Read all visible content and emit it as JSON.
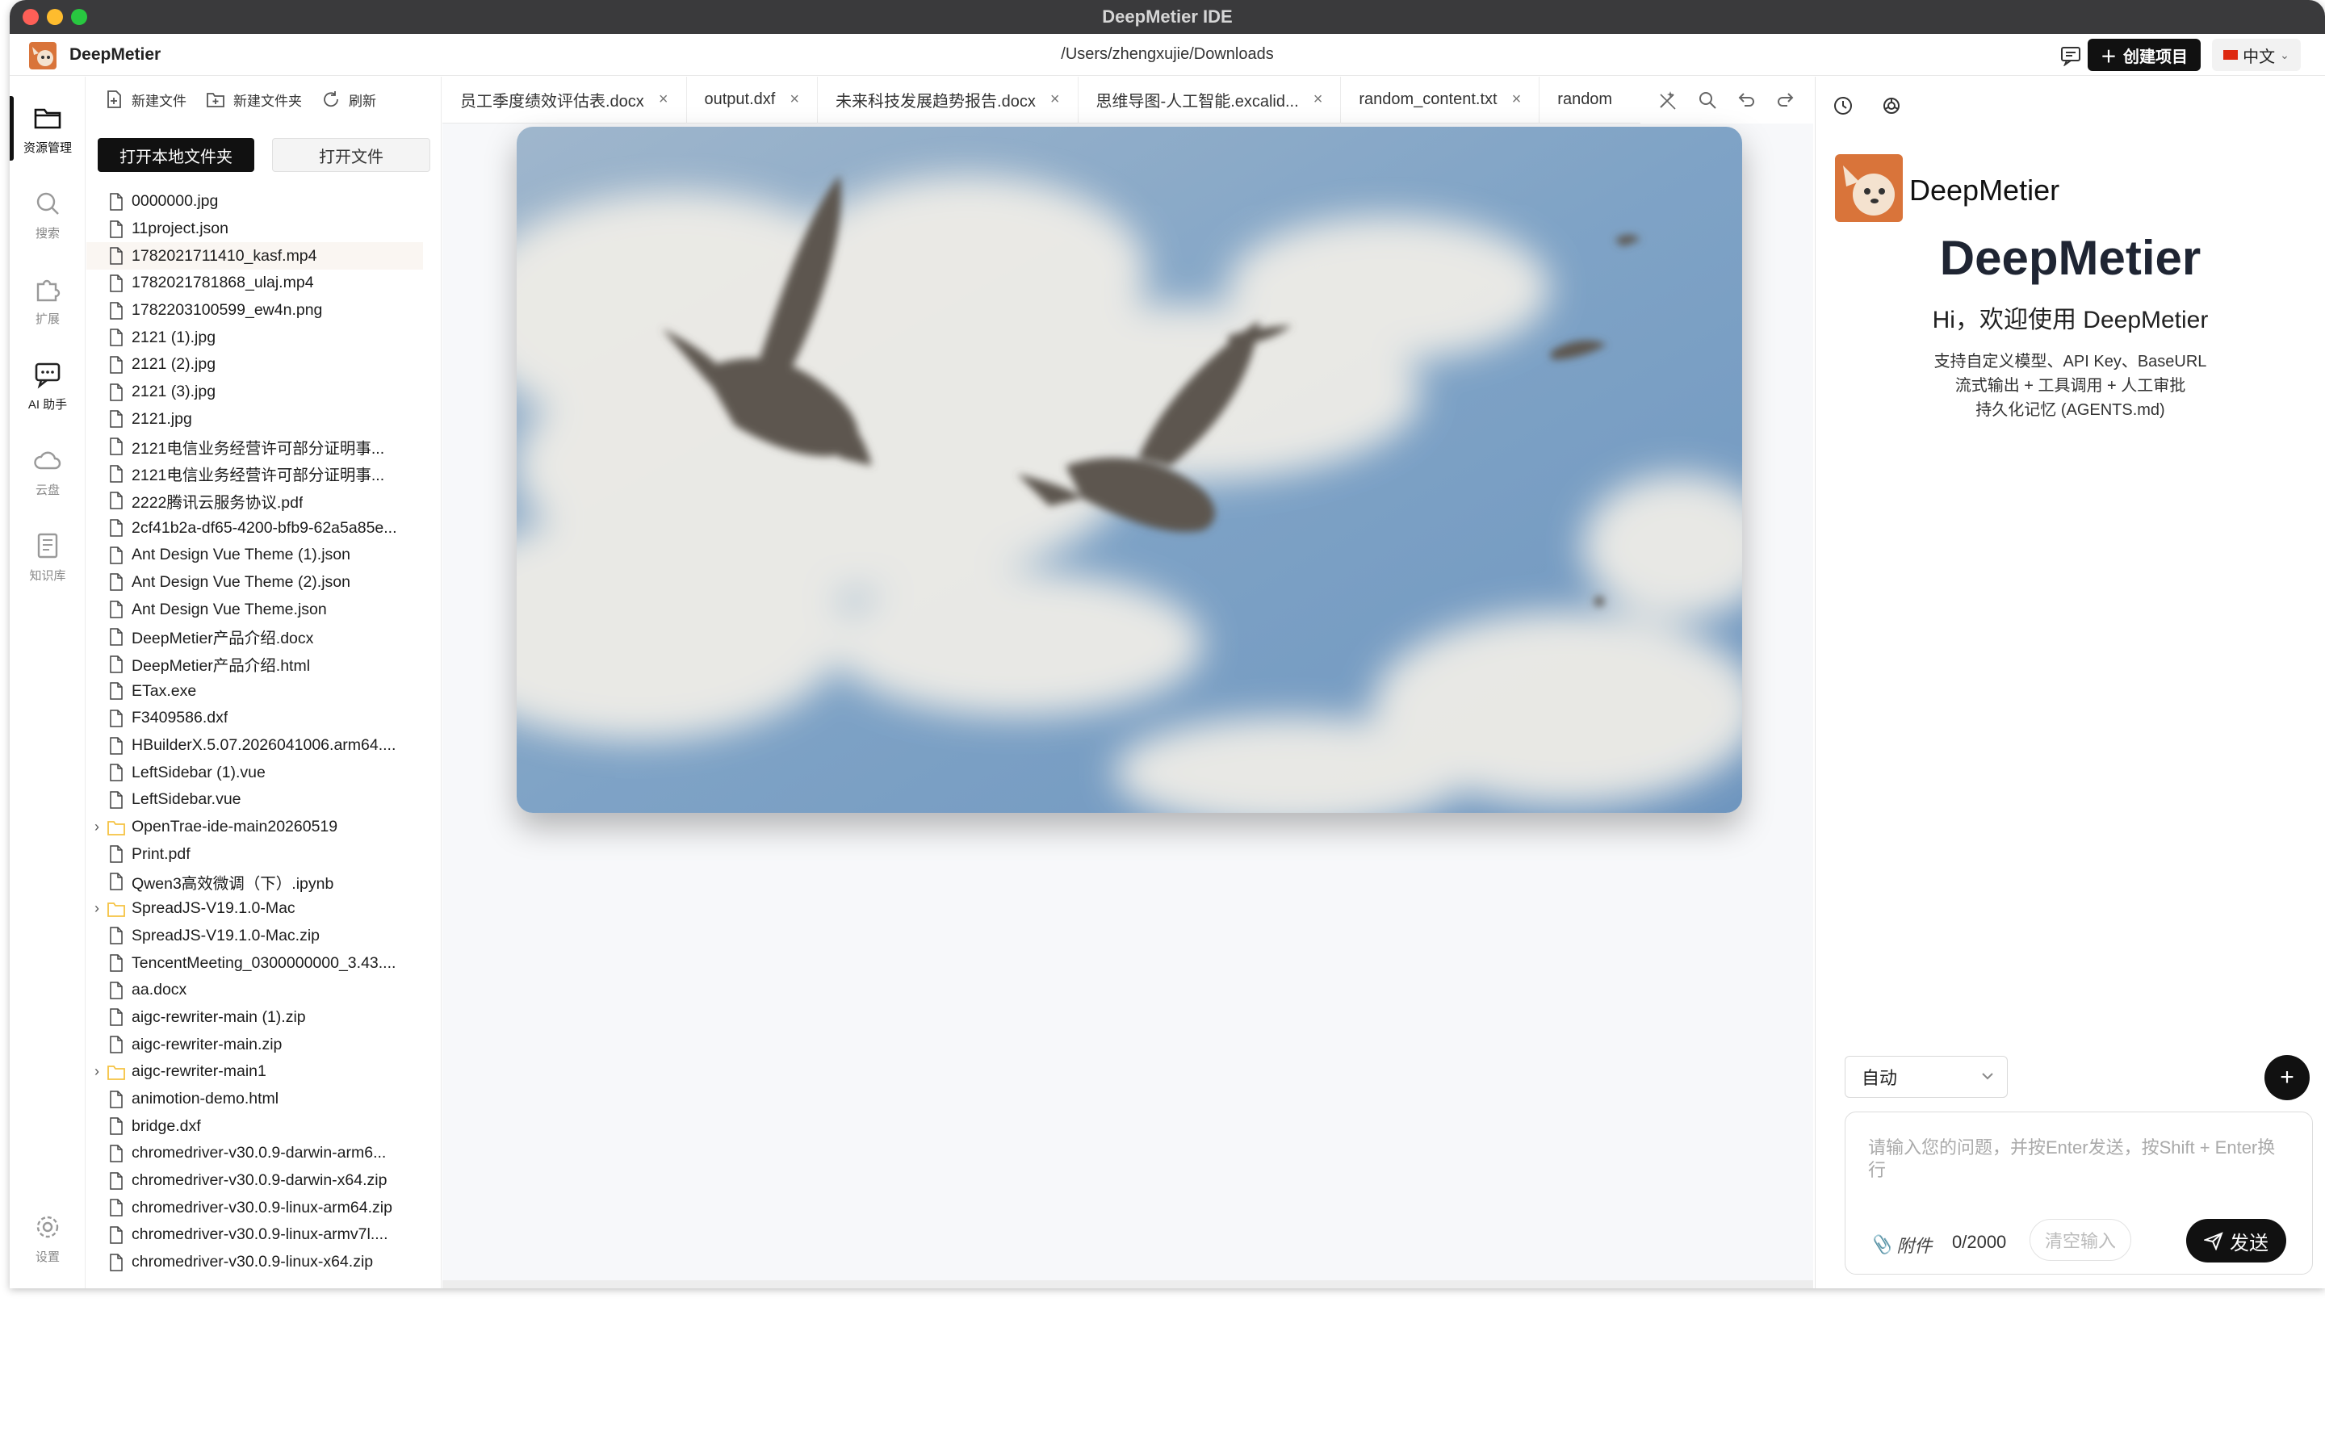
{
  "window": {
    "title": "DeepMetier IDE"
  },
  "header": {
    "brand": "DeepMetier",
    "path": "/Users/zhengxujie/Downloads",
    "create_label": "创建项目",
    "language": "中文"
  },
  "activity": {
    "items": [
      {
        "label": "资源管理",
        "icon": "folder-icon",
        "active": true
      },
      {
        "label": "搜索",
        "icon": "search-icon",
        "active": false
      },
      {
        "label": "扩展",
        "icon": "puzzle-icon",
        "active": false
      },
      {
        "label": "AI 助手",
        "icon": "chat-icon",
        "active": false
      },
      {
        "label": "云盘",
        "icon": "cloud-icon",
        "active": false
      },
      {
        "label": "知识库",
        "icon": "book-icon",
        "active": false
      }
    ],
    "settings_label": "设置"
  },
  "explorer": {
    "toolbar": {
      "new_file": "新建文件",
      "new_folder": "新建文件夹",
      "refresh": "刷新"
    },
    "open_local_folder": "打开本地文件夹",
    "open_file": "打开文件",
    "files": [
      {
        "name": "0000000.jpg",
        "type": "file"
      },
      {
        "name": "11project.json",
        "type": "file"
      },
      {
        "name": "1782021711410_kasf.mp4",
        "type": "file",
        "selected": true
      },
      {
        "name": "1782021781868_ulaj.mp4",
        "type": "file"
      },
      {
        "name": "1782203100599_ew4n.png",
        "type": "file"
      },
      {
        "name": "2121 (1).jpg",
        "type": "file"
      },
      {
        "name": "2121 (2).jpg",
        "type": "file"
      },
      {
        "name": "2121 (3).jpg",
        "type": "file"
      },
      {
        "name": "2121.jpg",
        "type": "file"
      },
      {
        "name": "2121电信业务经营许可部分证明事...",
        "type": "file"
      },
      {
        "name": "2121电信业务经营许可部分证明事...",
        "type": "file"
      },
      {
        "name": "2222腾讯云服务协议.pdf",
        "type": "file"
      },
      {
        "name": "2cf41b2a-df65-4200-bfb9-62a5a85e...",
        "type": "file"
      },
      {
        "name": "Ant Design Vue Theme (1).json",
        "type": "file"
      },
      {
        "name": "Ant Design Vue Theme (2).json",
        "type": "file"
      },
      {
        "name": "Ant Design Vue Theme.json",
        "type": "file"
      },
      {
        "name": "DeepMetier产品介绍.docx",
        "type": "file"
      },
      {
        "name": "DeepMetier产品介绍.html",
        "type": "file"
      },
      {
        "name": "ETax.exe",
        "type": "file"
      },
      {
        "name": "F3409586.dxf",
        "type": "file"
      },
      {
        "name": "HBuilderX.5.07.2026041006.arm64....",
        "type": "file"
      },
      {
        "name": "LeftSidebar (1).vue",
        "type": "file"
      },
      {
        "name": "LeftSidebar.vue",
        "type": "file"
      },
      {
        "name": "OpenTrae-ide-main20260519",
        "type": "folder"
      },
      {
        "name": "Print.pdf",
        "type": "file"
      },
      {
        "name": "Qwen3高效微调（下）.ipynb",
        "type": "file"
      },
      {
        "name": "SpreadJS-V19.1.0-Mac",
        "type": "folder"
      },
      {
        "name": "SpreadJS-V19.1.0-Mac.zip",
        "type": "file"
      },
      {
        "name": "TencentMeeting_0300000000_3.43....",
        "type": "file"
      },
      {
        "name": "aa.docx",
        "type": "file"
      },
      {
        "name": "aigc-rewriter-main (1).zip",
        "type": "file"
      },
      {
        "name": "aigc-rewriter-main.zip",
        "type": "file"
      },
      {
        "name": "aigc-rewriter-main1",
        "type": "folder"
      },
      {
        "name": "animotion-demo.html",
        "type": "file"
      },
      {
        "name": "bridge.dxf",
        "type": "file"
      },
      {
        "name": "chromedriver-v30.0.9-darwin-arm6...",
        "type": "file"
      },
      {
        "name": "chromedriver-v30.0.9-darwin-x64.zip",
        "type": "file"
      },
      {
        "name": "chromedriver-v30.0.9-linux-arm64.zip",
        "type": "file"
      },
      {
        "name": "chromedriver-v30.0.9-linux-armv7l....",
        "type": "file"
      },
      {
        "name": "chromedriver-v30.0.9-linux-x64.zip",
        "type": "file"
      }
    ]
  },
  "editor": {
    "tabs": [
      {
        "label": "员工季度绩效评估表.docx"
      },
      {
        "label": "output.dxf"
      },
      {
        "label": "未来科技发展趋势报告.docx"
      },
      {
        "label": "思维导图-人工智能.excalid..."
      },
      {
        "label": "random_content.txt"
      },
      {
        "label": "random"
      }
    ]
  },
  "assistant": {
    "logo_name": "DeepMetier",
    "title": "DeepMetier",
    "subtitle": "Hi，欢迎使用 DeepMetier",
    "desc1": "支持自定义模型、API Key、BaseURL",
    "desc2": "流式输出 + 工具调用 + 人工审批",
    "desc3": "持久化记忆 (AGENTS.md)",
    "mode": "自动",
    "placeholder": "请输入您的问题，并按Enter发送，按Shift + Enter换行",
    "attach_label": "附件",
    "char_count": "0/2000",
    "clear_label": "清空输入",
    "send_label": "发送"
  },
  "colors": {
    "accent": "#111111",
    "selected_row": "#faf6f2",
    "folder": "#f5c242"
  }
}
